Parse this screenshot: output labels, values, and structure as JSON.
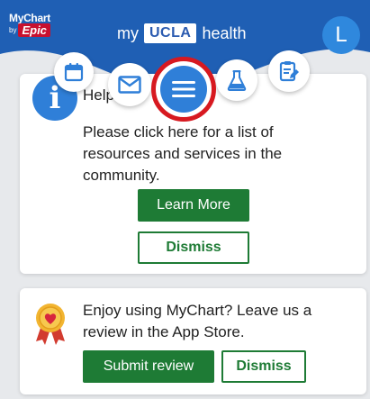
{
  "header": {
    "logo_line1": "MyChart",
    "logo_by": "by",
    "logo_epic": "Epic",
    "brand_prefix": "my",
    "brand_ucla": "UCLA",
    "brand_suffix": "health",
    "avatar_initial": "L"
  },
  "colors": {
    "header_blue": "#1f5fb4",
    "accent_blue": "#2f7fd8",
    "highlight_red": "#d71920",
    "button_green": "#1e7b35",
    "page_bg": "#e7e9ec"
  },
  "nav": {
    "items": [
      {
        "icon": "calendar-icon"
      },
      {
        "icon": "mail-icon"
      },
      {
        "icon": "menu-icon",
        "highlighted": true
      },
      {
        "icon": "flask-icon"
      },
      {
        "icon": "clipboard-edit-icon"
      }
    ]
  },
  "help_card": {
    "icon": "info-icon",
    "icon_glyph": "i",
    "title": "Help",
    "body": "Please click here for a list of resources and services in the community.",
    "learn_more_label": "Learn More",
    "dismiss_label": "Dismiss"
  },
  "review_card": {
    "icon": "award-ribbon-icon",
    "body": "Enjoy using MyChart? Leave us a review in the App Store.",
    "submit_label": "Submit review",
    "dismiss_label": "Dismiss"
  }
}
